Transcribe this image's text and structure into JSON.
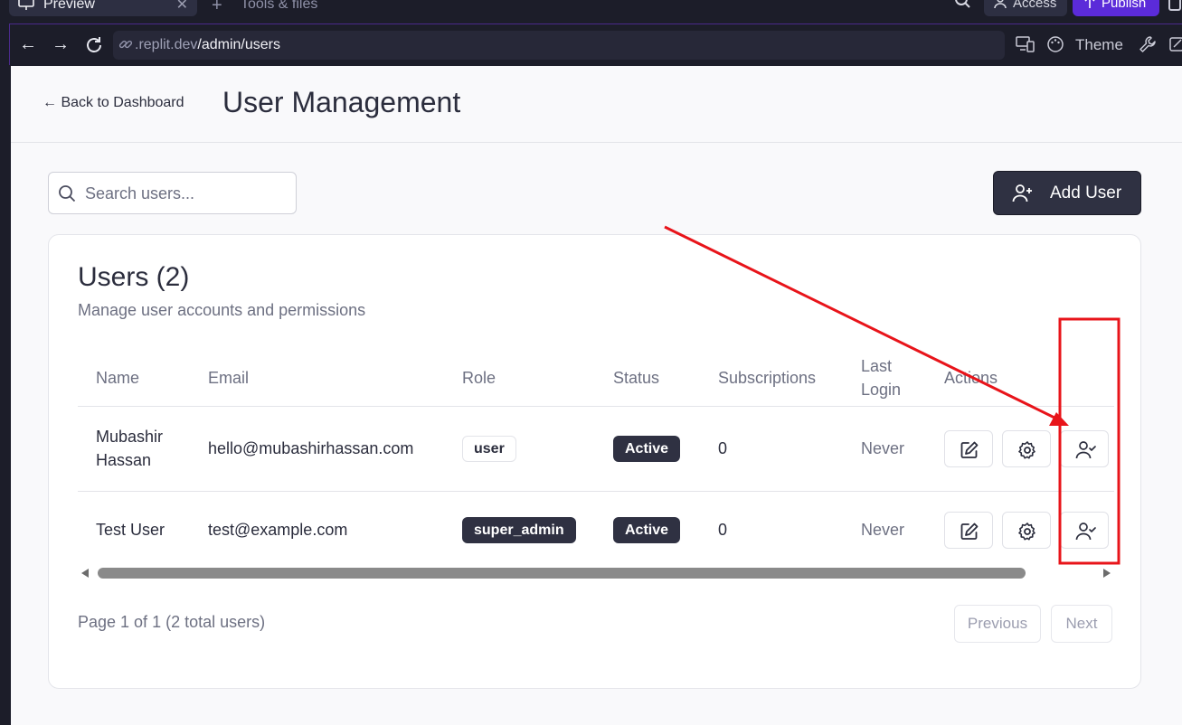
{
  "top_tabs": {
    "preview_label": "Preview",
    "tools_label": "Tools & files",
    "access_label": "Access",
    "publish_label": "Publish"
  },
  "browser": {
    "url_prefix": ".replit.dev",
    "url_path": "/admin/users",
    "theme_label": "Theme"
  },
  "header": {
    "back_label": "← Back to Dashboard",
    "title": "User Management"
  },
  "toolbar": {
    "search_placeholder": "Search users...",
    "add_user_label": "Add User"
  },
  "card": {
    "title": "Users (2)",
    "subtitle": "Manage user accounts and permissions"
  },
  "table": {
    "columns": [
      "Name",
      "Email",
      "Role",
      "Status",
      "Subscriptions",
      "Last Login",
      "Actions"
    ],
    "col_last_login_1": "Last",
    "col_last_login_2": "Login",
    "rows": [
      {
        "name_1": "Mubashir",
        "name_2": "Hassan",
        "email": "hello@mubashirhassan.com",
        "role": "user",
        "status": "Active",
        "subscriptions": "0",
        "last_login": "Never"
      },
      {
        "name": "Test User",
        "email": "test@example.com",
        "role": "super_admin",
        "status": "Active",
        "subscriptions": "0",
        "last_login": "Never"
      }
    ]
  },
  "pagination": {
    "info": "Page 1 of 1 (2 total users)",
    "previous_label": "Previous",
    "next_label": "Next"
  },
  "colors": {
    "annotation": "#e8141a",
    "primary_dark": "#2f3142",
    "publish": "#5b2bd9"
  }
}
